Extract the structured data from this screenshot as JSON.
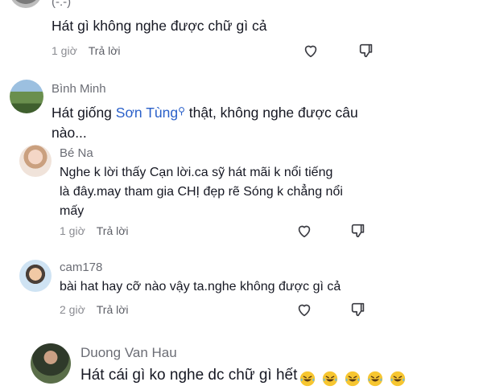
{
  "comments": [
    {
      "username": "(-.-)",
      "text": "Hát gì không nghe được chữ gì cả",
      "time": "1 giờ",
      "reply_label": "Trả lời"
    },
    {
      "username": "Bình Minh",
      "text_before": "Hát giống ",
      "mention": "Sơn Tùng",
      "text_after": " thật, không nghe được câu nào...",
      "line2": "nào..."
    },
    {
      "username": "Bé Na",
      "text_lines": [
        "Nghe k lời thấy Cạn lời.ca sỹ hát mãi k nổi tiếng",
        "là đây.may tham gia CHỊ đẹp rẽ Sóng k chẳng nổi",
        "mấy"
      ],
      "time": "1 giờ",
      "reply_label": "Trả lời"
    },
    {
      "username": "cam178",
      "text": "bài hat hay cỡ nào vậy ta.nghe không được gì cả",
      "time": "2 giờ",
      "reply_label": "Trả lời"
    },
    {
      "username": "Duong Van Hau",
      "text": "Hát cái gì ko nghe dc chữ gì hết",
      "emoji_count": 5
    }
  ]
}
